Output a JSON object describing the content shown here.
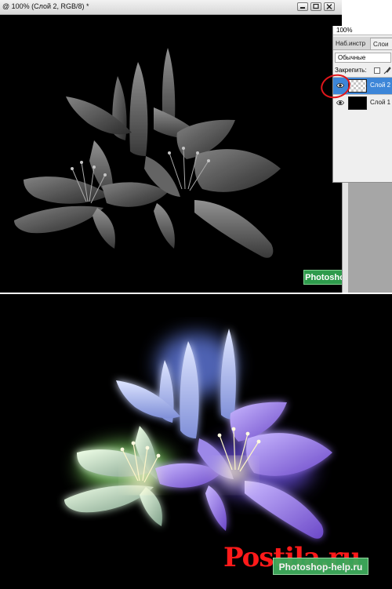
{
  "document": {
    "title": "@ 100% (Слой 2, RGB/8) *"
  },
  "layers_panel": {
    "zoom": "100%",
    "tabs": [
      {
        "label": "Наб.инстр"
      },
      {
        "label": "Слои"
      }
    ],
    "blend_mode": "Обычные",
    "lock_label": "Закрепить:",
    "layers": [
      {
        "name": "Слой 2",
        "selected": true,
        "thumbnail": "transparent-checker"
      },
      {
        "name": "Слой 1",
        "selected": false,
        "thumbnail": "black"
      }
    ]
  },
  "watermarks": {
    "top": "Photoshop-help.ru",
    "bottom": "Photoshop-help.ru"
  },
  "site_logo": "Postila.ru",
  "colors": {
    "selection": "#3d86d8",
    "highlight_circle": "#e0161b",
    "watermark_green": "#2e9b4c",
    "logo_red": "#ff1a1a"
  }
}
